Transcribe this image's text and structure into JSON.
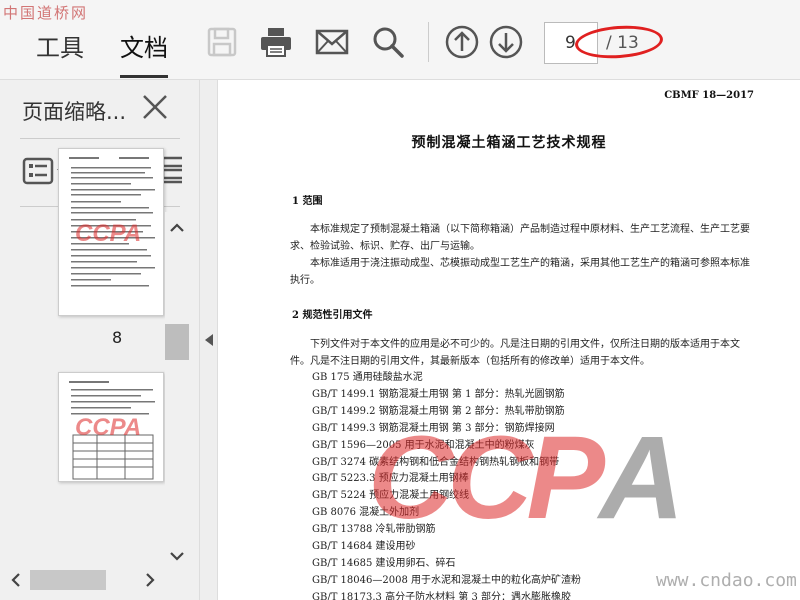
{
  "site_logo": "中国道桥网",
  "toolbar": {
    "tabs": [
      {
        "label": "工具"
      },
      {
        "label": "文档"
      }
    ],
    "icons": [
      "save-icon",
      "print-icon",
      "mail-icon",
      "search-icon",
      "page-up-icon",
      "page-down-icon"
    ],
    "page_current": "9",
    "page_total": "/ 13",
    "annotation_color": "#e02020"
  },
  "panel": {
    "title": "页面缩略...",
    "thumbnails": [
      {
        "label": "8"
      },
      {
        "label": ""
      }
    ],
    "thumb_watermark": "CCPA"
  },
  "document": {
    "code": "CBMF 18—2017",
    "title": "预制混凝土箱涵工艺技术规程",
    "sections": [
      {
        "heading": "1   范围",
        "paragraphs": [
          "本标准规定了预制混凝土箱涵（以下简称箱涵）产品制造过程中原材料、生产工艺流程、生产工艺要求、检验试验、标识、贮存、出厂与运输。",
          "本标准适用于浇注振动成型、芯模振动成型工艺生产的箱涵，采用其他工艺生产的箱涵可参照本标准执行。"
        ]
      },
      {
        "heading": "2   规范性引用文件",
        "paragraphs": [
          "下列文件对于本文件的应用是必不可少的。凡是注日期的引用文件，仅所注日期的版本适用于本文件。凡是不注日期的引用文件，其最新版本（包括所有的修改单）适用于本文件。"
        ]
      }
    ],
    "references": [
      "GB 175   通用硅酸盐水泥",
      "GB/T 1499.1   钢筋混凝土用钢   第 1 部分：热轧光圆钢筋",
      "GB/T 1499.2   钢筋混凝土用钢   第 2 部分：热轧带肋钢筋",
      "GB/T 1499.3   钢筋混凝土用钢   第 3 部分：钢筋焊接网",
      "GB/T 1596—2005   用于水泥和混凝土中的粉煤灰",
      "GB/T 3274   碳素结构钢和低合金结构钢热轧钢板和钢带",
      "GB/T 5223.3   预应力混凝土用钢棒",
      "GB/T 5224   预应力混凝土用钢绞线",
      "GB 8076   混凝土外加剂",
      "GB/T 13788   冷轧带肋钢筋",
      "GB/T 14684   建设用砂",
      "GB/T 14685   建设用卵石、碎石",
      "GB/T 18046—2008   用于水泥和混凝土中的粒化高炉矿渣粉",
      "GB/T 18173.3   高分子防水材料   第 3 部分：遇水膨胀橡胶"
    ],
    "watermark": {
      "main": "CCP",
      "tail": "A"
    }
  },
  "site_url": "www.cndao.com"
}
